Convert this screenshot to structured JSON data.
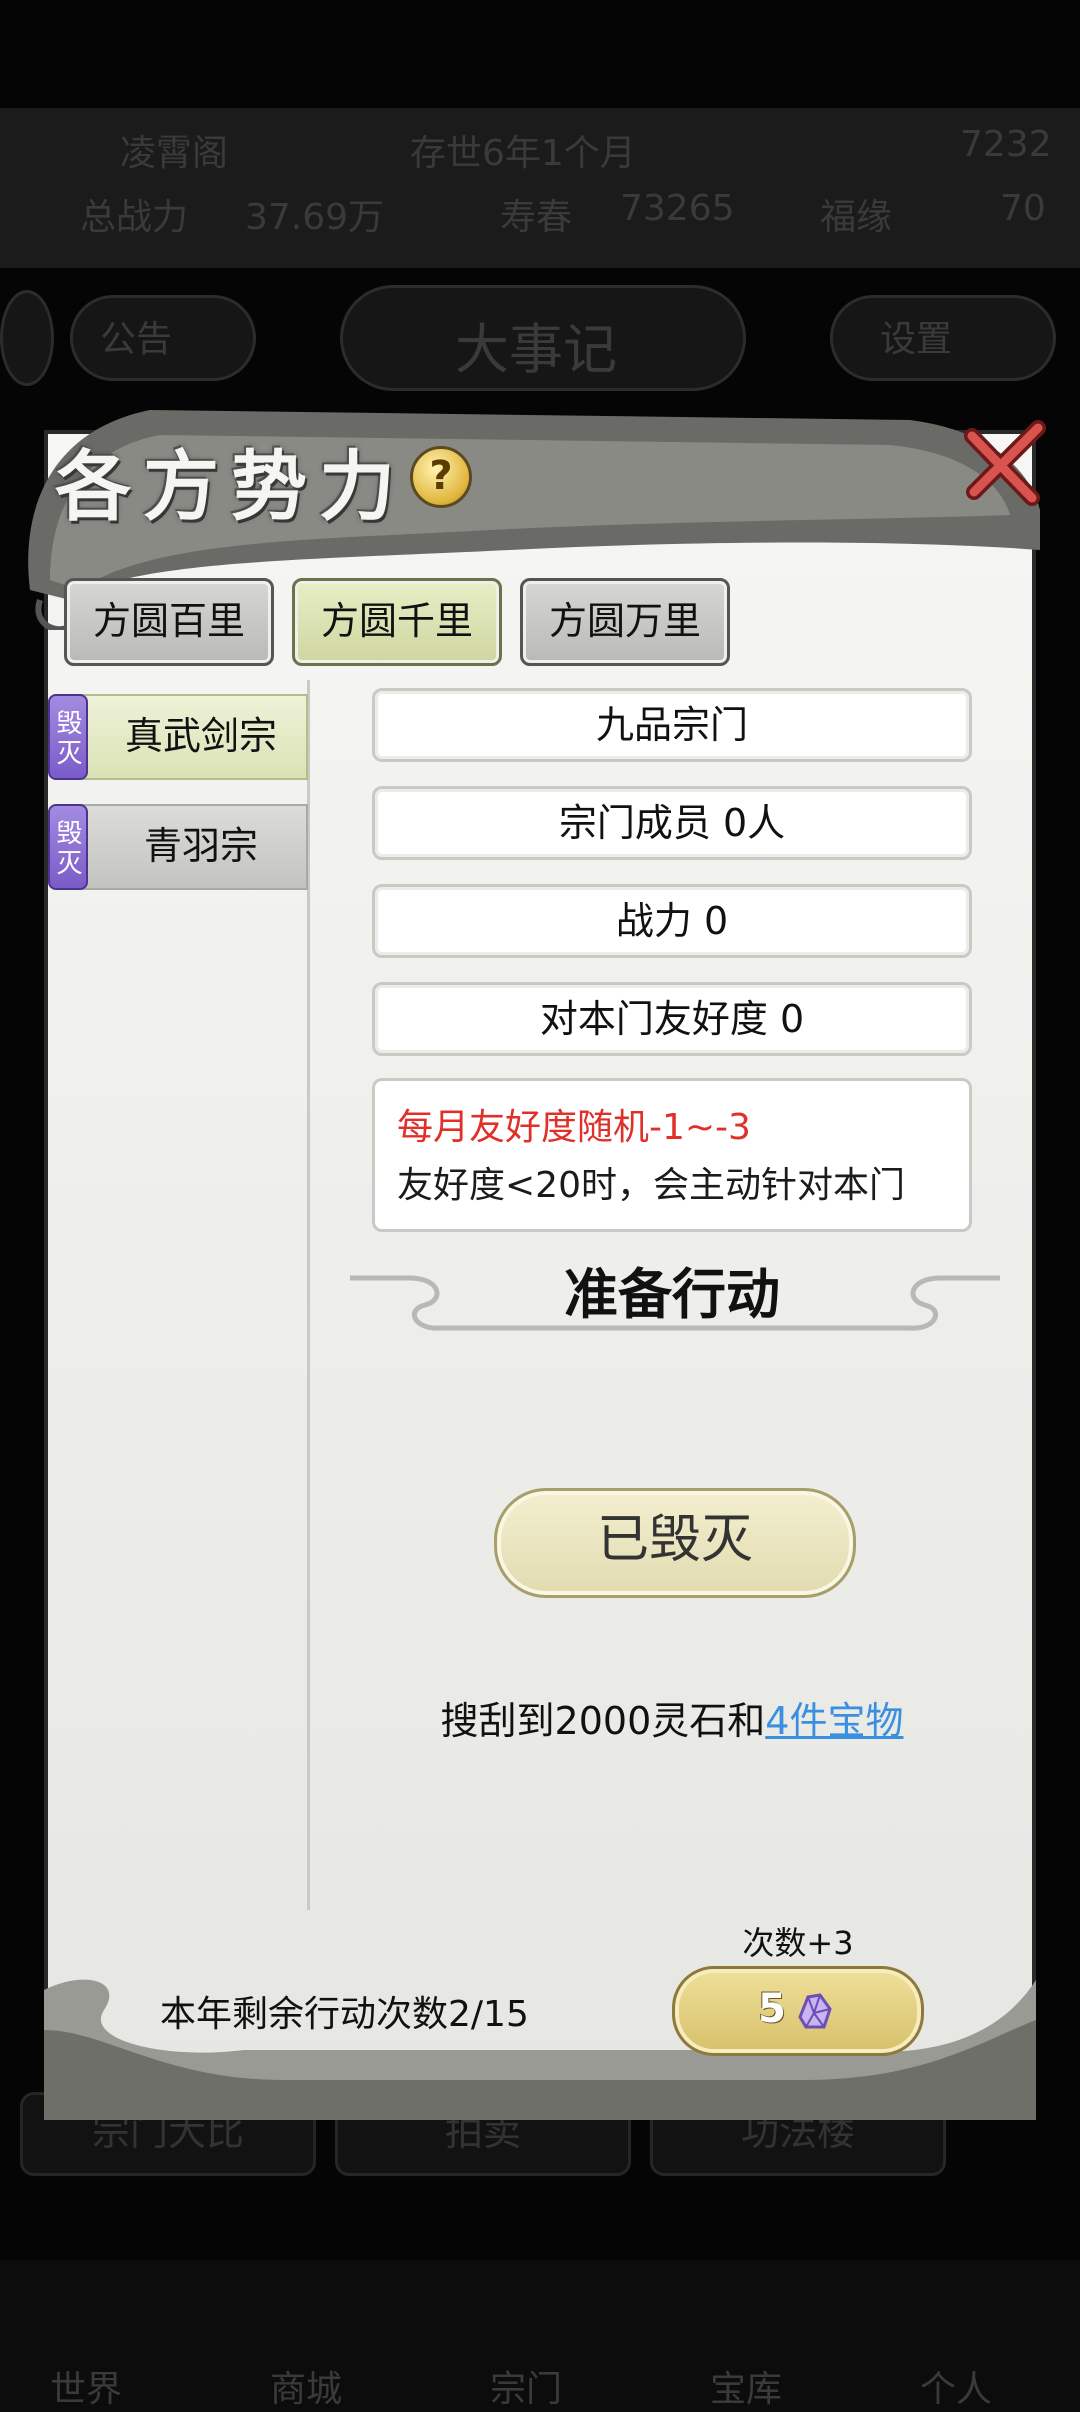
{
  "background": {
    "top_bar": [
      "凌霄阁",
      "存世6年1个月",
      "7232"
    ],
    "stats_bar": [
      "总战力",
      "37.69万",
      "寿春",
      "73265",
      "福缘",
      "70"
    ],
    "nav": {
      "center_label": "大事记",
      "left_label": "公告",
      "right_label": "设置"
    },
    "bottom_buttons": [
      "宗门大比",
      "拍卖",
      "功法楼"
    ],
    "bottom_nav": [
      "世界",
      "商城",
      "宗门",
      "宝库",
      "个人"
    ]
  },
  "modal": {
    "title": "各方势力",
    "help_symbol": "?",
    "tabs": [
      {
        "label": "方圆百里",
        "active": false
      },
      {
        "label": "方圆千里",
        "active": true
      },
      {
        "label": "方圆万里",
        "active": false
      }
    ],
    "sects": [
      {
        "badge": "毁灭",
        "name": "真武剑宗",
        "active": true
      },
      {
        "badge": "毁灭",
        "name": "青羽宗",
        "active": false
      }
    ],
    "info": {
      "rank": "九品宗门",
      "members": "宗门成员 0人",
      "power": "战力 0",
      "friendship": "对本门友好度 0"
    },
    "note": {
      "line1": "每月友好度随机-1~-3",
      "line2": "友好度<20时，会主动针对本门"
    },
    "section_title": "准备行动",
    "destroyed_label": "已毁灭",
    "loot": {
      "prefix": "搜刮到2000灵石和",
      "link": "4件宝物"
    },
    "remaining_actions": "本年剩余行动次数2/15",
    "times_plus": "次数+3",
    "cost": "5",
    "colors": {
      "red_note": "#e0302a",
      "link": "#3b8fe0",
      "active_tab": "#cfd6a0",
      "badge": "#7a5cc9"
    }
  }
}
